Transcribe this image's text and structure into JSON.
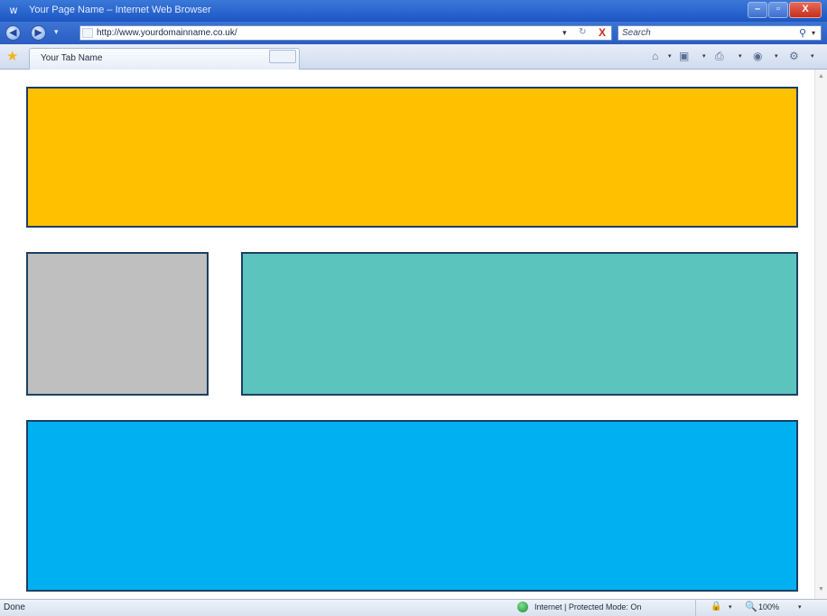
{
  "window": {
    "app_icon": "W",
    "title": "Your Page Name – Internet Web Browser",
    "min_label": "–",
    "max_label": "▫",
    "close_label": "X"
  },
  "nav": {
    "back_glyph": "◀",
    "forward_glyph": "▶",
    "dropdown_glyph": "▾",
    "url": "http://www.yourdomainname.co.uk/",
    "address_dropdown_glyph": "▾",
    "refresh_glyph": "↻",
    "stop_glyph": "X",
    "search_placeholder": "Search",
    "search_glyph": "⚲",
    "search_dropdown_glyph": "▾"
  },
  "tabs": {
    "favorites_glyph": "★",
    "active_tab_label": "Your Tab Name"
  },
  "commandbar": {
    "home_glyph": "⌂",
    "feeds_glyph": "▣",
    "print_glyph": "⎙",
    "page_glyph": "◉",
    "tools_glyph": "⚙",
    "dropdown_glyph": "▾"
  },
  "content": {
    "blocks": [
      {
        "name": "header-block",
        "color": "#FFC000"
      },
      {
        "name": "sidebar-block",
        "color": "#BFBFBF"
      },
      {
        "name": "main-content-block",
        "color": "#5BC4BD"
      },
      {
        "name": "footer-block",
        "color": "#00B0F0"
      }
    ],
    "scroll_up_glyph": "▲",
    "scroll_down_glyph": "▼"
  },
  "statusbar": {
    "status": "Done",
    "zone": "Internet | Protected Mode: On",
    "lock_glyph": "🔒",
    "dropdown_glyph": "▾",
    "zoom_glyph": "🔍",
    "zoom": "100%"
  }
}
